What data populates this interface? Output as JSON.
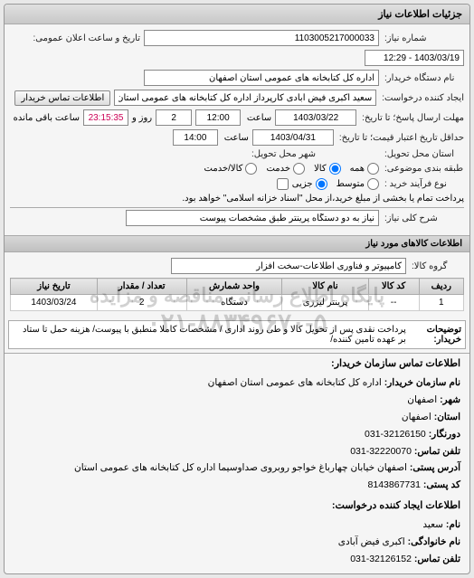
{
  "panel": {
    "title": "جزئیات اطلاعات نیاز"
  },
  "form": {
    "req_no_label": "شماره نیاز:",
    "req_no": "1103005217000033",
    "announce_label": "تاریخ و ساعت اعلان عمومی:",
    "announce_value": "1403/03/19 - 12:29",
    "buyer_label": "نام دستگاه خریدار:",
    "buyer": "اداره کل کتابخانه های عمومی استان اصفهان",
    "creator_label": "ایجاد کننده درخواست:",
    "creator": "سعید اکبری فیض آبادی کارپرداز اداره کل کتابخانه های عمومی استان اصفهان",
    "contact_btn": "اطلاعات تماس خریدار",
    "deadline_resp_label": "مهلت ارسال پاسخ؛ تا تاریخ:",
    "deadline_resp_date": "1403/03/22",
    "hour_label": "ساعت",
    "deadline_resp_time": "12:00",
    "remain_days": "2",
    "days_label": "روز و",
    "remain_time": "23:15:35",
    "remain_label": "ساعت باقی مانده",
    "min_valid_label": "حداقل تاریخ اعتبار قیمت؛ تا تاریخ:",
    "min_valid_date": "1403/04/31",
    "min_valid_time": "14:00",
    "deliver_state_label": "استان محل تحویل:",
    "deliver_city_label": "شهر محل تحویل:",
    "class_label": "طبقه بندی موضوعی:",
    "class_all": "همه",
    "class_goods": "کالا",
    "class_service": "خدمت",
    "class_goods_service": "کالا/خدمت",
    "process_label": "نوع فرآیند خرید :",
    "proc_mid": "متوسط",
    "proc_partial": "جزیی",
    "process_note": "پرداخت تمام یا بخشی از مبلغ خرید،از محل \"اسناد خزانه اسلامی\" خواهد بود."
  },
  "need": {
    "title_label": "شرح کلی نیاز:",
    "title": "نیاز به دو دستگاه پرینتر طبق مشخصات پیوست",
    "items_header": "اطلاعات کالاهای مورد نیاز",
    "group_label": "گروه کالا:",
    "group": "کامپیوتر و فناوری اطلاعات-سخت افزار"
  },
  "table": {
    "headers": [
      "ردیف",
      "کد کالا",
      "نام کالا",
      "واحد شمارش",
      "تعداد / مقدار",
      "تاریخ نیاز"
    ],
    "rows": [
      {
        "idx": "1",
        "code": "--",
        "name": "پرینتر لیزری",
        "unit": "دستگاه",
        "qty": "2",
        "date": "1403/03/24"
      }
    ]
  },
  "buyer_notes": {
    "label": "توضیحات خریدار:",
    "text": "پرداخت نقدی پس از تحویل کالا و طی روند اداری / مشخصات کاملا منطبق با پیوست/ هزینه حمل تا ستاد بر عهده تامین کننده/"
  },
  "watermark": {
    "line1": "پایگاه اطلاع رسانی مناقصه و مزایده",
    "line2": "۰۲۱-۸۸۳۴۹۶۷۰-۵"
  },
  "contact": {
    "header": "اطلاعات تماس سازمان خریدار:",
    "org_label": "نام سازمان خریدار:",
    "org": "اداره کل کتابخانه های عمومی استان اصفهان",
    "city_label": "شهر:",
    "city": "اصفهان",
    "province_label": "استان:",
    "province": "اصفهان",
    "fax_label": "دورنگار:",
    "fax": "32126150-031",
    "phone_label": "تلفن تماس:",
    "phone": "32220070-031",
    "address_label": "آدرس پستی:",
    "address": "اصفهان خیابان چهارباغ خواجو روبروی صداوسیما اداره کل کتابخانه های عمومی استان",
    "postal_label": "کد پستی:",
    "postal": "8143867731",
    "req_creator_header": "اطلاعات ایجاد کننده درخواست:",
    "fname_label": "نام:",
    "fname": "سعید",
    "lname_label": "نام خانوادگی:",
    "lname": "اکبری فیض آبادی",
    "cphone_label": "تلفن تماس:",
    "cphone": "32126152-031"
  }
}
